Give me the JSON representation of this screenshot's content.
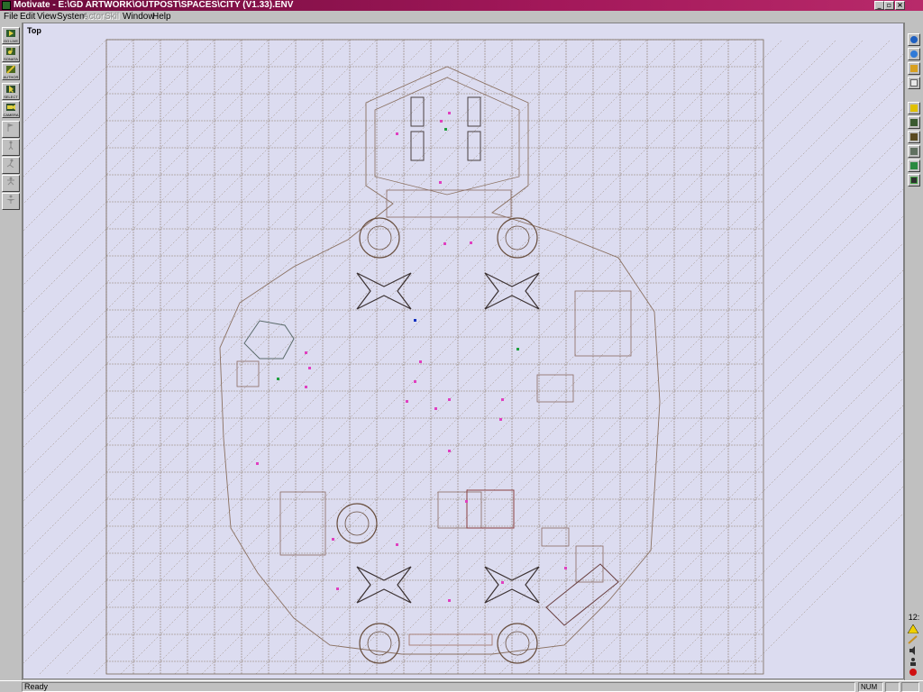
{
  "window": {
    "title": "Motivate - E:\\GD ARTWORK\\OUTPOST\\SPACES\\CITY (V1.33).ENV",
    "minimize_glyph": "_",
    "maximize_glyph": "▫",
    "close_glyph": "×"
  },
  "menu": {
    "items": [
      {
        "label": "File",
        "enabled": true
      },
      {
        "label": "Edit",
        "enabled": true
      },
      {
        "label": "View",
        "enabled": true
      },
      {
        "label": "System",
        "enabled": true
      },
      {
        "label": "Actor",
        "enabled": false
      },
      {
        "label": "Skil",
        "enabled": false
      },
      {
        "label": "Window",
        "enabled": true
      },
      {
        "label": "Help",
        "enabled": true
      }
    ]
  },
  "left_toolbar": {
    "tools": [
      {
        "label": "GO LIVE",
        "icon": "play-icon",
        "enabled": true
      },
      {
        "label": "SONATA",
        "icon": "music-icon",
        "enabled": true
      },
      {
        "label": "AUTHOR",
        "icon": "pencil-icon",
        "enabled": true
      },
      {
        "label": "SELECT",
        "icon": "cursor-icon",
        "enabled": true
      },
      {
        "label": "CAMERA",
        "icon": "camera-icon",
        "enabled": true
      },
      {
        "label": "",
        "icon": "flag-icon",
        "enabled": false
      },
      {
        "label": "",
        "icon": "walk-icon",
        "enabled": false
      },
      {
        "label": "",
        "icon": "run-icon",
        "enabled": false
      },
      {
        "label": "",
        "icon": "jump-icon",
        "enabled": false
      },
      {
        "label": "",
        "icon": "fly-icon",
        "enabled": false
      }
    ]
  },
  "right_toolbar": {
    "tools": [
      {
        "icon": "globe-icon",
        "color": "#1e5fc0"
      },
      {
        "icon": "globe-icon",
        "color": "#2f7ad8"
      },
      {
        "icon": "pencil-icon",
        "color": "#d8a020"
      },
      {
        "icon": "document-icon",
        "color": "#c8c8c8"
      },
      {
        "icon": "folder-icon",
        "color": "#e0c000"
      },
      {
        "icon": "image-icon",
        "color": "#3a5a30"
      },
      {
        "icon": "image-icon",
        "color": "#5a4a20"
      },
      {
        "icon": "camera-icon",
        "color": "#607060"
      },
      {
        "icon": "tree-icon",
        "color": "#2a8a40"
      },
      {
        "icon": "monitor-icon",
        "color": "#303030"
      }
    ],
    "clock": "12:"
  },
  "viewport": {
    "label": "Top"
  },
  "status": {
    "text": "Ready",
    "num": "NUM"
  }
}
